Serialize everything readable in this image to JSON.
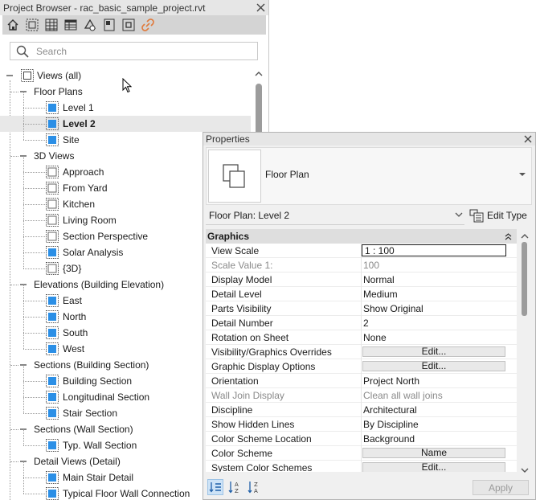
{
  "project_browser": {
    "title": "Project Browser - rac_basic_sample_project.rvt",
    "search_placeholder": "Search",
    "tree": [
      {
        "label": "Views (all)",
        "level": 0,
        "icon": "views",
        "toggle": "collapse"
      },
      {
        "label": "Floor Plans",
        "level": 1,
        "toggle": "collapse"
      },
      {
        "label": "Level 1",
        "level": 2,
        "icon": "plan"
      },
      {
        "label": "Level 2",
        "level": 2,
        "icon": "plan",
        "selected": true
      },
      {
        "label": "Site",
        "level": 2,
        "icon": "plan"
      },
      {
        "label": "3D Views",
        "level": 1,
        "toggle": "collapse"
      },
      {
        "label": "Approach",
        "level": 2,
        "icon": "3d"
      },
      {
        "label": "From Yard",
        "level": 2,
        "icon": "3d"
      },
      {
        "label": "Kitchen",
        "level": 2,
        "icon": "3d"
      },
      {
        "label": "Living Room",
        "level": 2,
        "icon": "3d"
      },
      {
        "label": "Section Perspective",
        "level": 2,
        "icon": "3d"
      },
      {
        "label": "Solar Analysis",
        "level": 2,
        "icon": "plan"
      },
      {
        "label": "{3D}",
        "level": 2,
        "icon": "3d"
      },
      {
        "label": "Elevations (Building Elevation)",
        "level": 1,
        "toggle": "collapse"
      },
      {
        "label": "East",
        "level": 2,
        "icon": "plan"
      },
      {
        "label": "North",
        "level": 2,
        "icon": "plan"
      },
      {
        "label": "South",
        "level": 2,
        "icon": "plan"
      },
      {
        "label": "West",
        "level": 2,
        "icon": "plan"
      },
      {
        "label": "Sections (Building Section)",
        "level": 1,
        "toggle": "collapse"
      },
      {
        "label": "Building Section",
        "level": 2,
        "icon": "plan"
      },
      {
        "label": "Longitudinal Section",
        "level": 2,
        "icon": "plan"
      },
      {
        "label": "Stair Section",
        "level": 2,
        "icon": "plan"
      },
      {
        "label": "Sections (Wall Section)",
        "level": 1,
        "toggle": "collapse"
      },
      {
        "label": "Typ. Wall Section",
        "level": 2,
        "icon": "plan"
      },
      {
        "label": "Detail Views (Detail)",
        "level": 1,
        "toggle": "collapse"
      },
      {
        "label": "Main Stair Detail",
        "level": 2,
        "icon": "plan"
      },
      {
        "label": "Typical Floor Wall Connection",
        "level": 2,
        "icon": "plan"
      }
    ]
  },
  "properties": {
    "title": "Properties",
    "type_name": "Floor Plan",
    "instance_label": "Floor Plan: Level 2",
    "edit_type_label": "Edit Type",
    "group": "Graphics",
    "rows": [
      {
        "name": "View Scale",
        "value": "1 : 100",
        "kind": "input"
      },
      {
        "name": "Scale Value    1:",
        "value": "100",
        "kind": "text",
        "gray": true
      },
      {
        "name": "Display Model",
        "value": "Normal",
        "kind": "text"
      },
      {
        "name": "Detail Level",
        "value": "Medium",
        "kind": "text"
      },
      {
        "name": "Parts Visibility",
        "value": "Show Original",
        "kind": "text"
      },
      {
        "name": "Detail Number",
        "value": "2",
        "kind": "text"
      },
      {
        "name": "Rotation on Sheet",
        "value": "None",
        "kind": "text"
      },
      {
        "name": "Visibility/Graphics Overrides",
        "value": "Edit...",
        "kind": "button"
      },
      {
        "name": "Graphic Display Options",
        "value": "Edit...",
        "kind": "button"
      },
      {
        "name": "Orientation",
        "value": "Project North",
        "kind": "text"
      },
      {
        "name": "Wall Join Display",
        "value": "Clean all wall joins",
        "kind": "text",
        "gray": true
      },
      {
        "name": "Discipline",
        "value": "Architectural",
        "kind": "text"
      },
      {
        "name": "Show Hidden Lines",
        "value": "By Discipline",
        "kind": "text"
      },
      {
        "name": "Color Scheme Location",
        "value": "Background",
        "kind": "text"
      },
      {
        "name": "Color Scheme",
        "value": "Name",
        "kind": "button"
      },
      {
        "name": "System Color Schemes",
        "value": "Edit...",
        "kind": "button"
      }
    ],
    "apply_label": "Apply"
  },
  "colors": {
    "view_icon_blue": "#2b8fe6",
    "selected_row": "#e8e8e8",
    "link_icon": "#e07a3c"
  }
}
